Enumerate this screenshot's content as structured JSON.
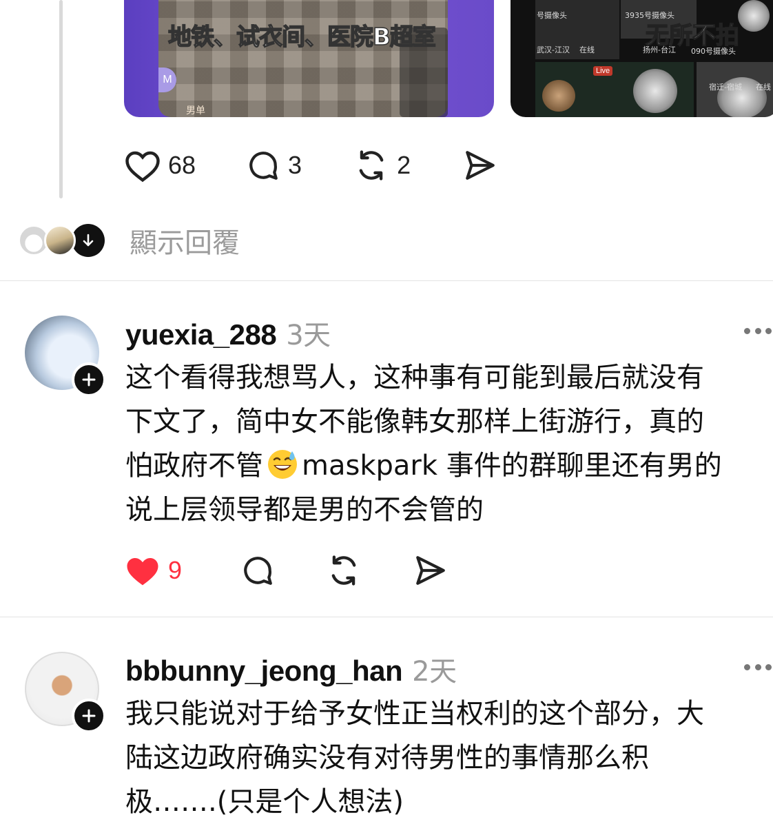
{
  "post": {
    "media": [
      {
        "caption": "地铁、试衣间、医院B超室",
        "letter": "M",
        "sub": "男单"
      },
      {
        "caption": "无所不拍",
        "live": "Live",
        "labels": [
          "号摄像头",
          "3935号摄像头",
          "武汉-江汉",
          "在线",
          "扬州-台江",
          "090号摄像头",
          "宿迁-宿城",
          "在线"
        ]
      }
    ],
    "actions": {
      "likes": "68",
      "replies": "3",
      "reposts": "2"
    }
  },
  "show_replies": {
    "label": "顯示回覆"
  },
  "comments": [
    {
      "username": "yuexia_288",
      "time": "3天",
      "lines": [
        "这个看得我想骂人，这种事有可能到最后就没有",
        "下文了，简中女不能像韩女那样上街游行，真的",
        "怕政府不管",
        "maskpark 事件的群聊里还有男的",
        "说上层领导都是男的不会管的"
      ],
      "likes": "9",
      "liked": true
    },
    {
      "username": "bbbunny_jeong_han",
      "time": "2天",
      "lines": [
        "我只能说对于给予女性正当权利的这个部分，大",
        "陆这边政府确实没有对待男性的事情那么积",
        "极…….(只是个人想法)"
      ]
    }
  ],
  "icons": {
    "heart": "heart-icon",
    "reply": "reply-icon",
    "repost": "repost-icon",
    "share": "share-icon",
    "more": "more-icon",
    "follow": "plus-icon",
    "down": "arrow-down-icon",
    "emoji": "sweat-smile-emoji"
  },
  "colors": {
    "like_red": "#ff3040",
    "muted": "#9a9a9a"
  }
}
